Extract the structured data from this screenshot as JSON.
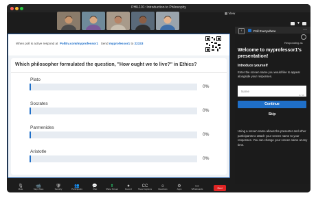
{
  "window": {
    "title": "PHIL101: Introduction to Philosophy"
  },
  "participants": [
    {
      "name": "participant-1",
      "skin": "#c8966e",
      "shirt": "#4a4a4a",
      "bg": "#8a7b6a"
    },
    {
      "name": "participant-2",
      "skin": "#d9a982",
      "shirt": "#7a5a9a",
      "bg": "#6f8a9a"
    },
    {
      "name": "participant-3",
      "skin": "#b78467",
      "shirt": "#c9bfb0",
      "bg": "#a89a8a"
    },
    {
      "name": "participant-4",
      "skin": "#8b5e45",
      "shirt": "#2f2f2f",
      "bg": "#5a6a7a"
    },
    {
      "name": "participant-5",
      "skin": "#e3b38f",
      "shirt": "#3f6ea8",
      "bg": "#9aa4ad"
    }
  ],
  "view_label": "View",
  "poll": {
    "header": {
      "prefix": "When poll is active respond at",
      "url": "PollEv.com/myprofessor1",
      "send": "Send",
      "code": "myprofessor1",
      "to": "to",
      "number": "22333"
    },
    "question": "Which philosopher formulated the question, \"How ought we to live?\" in Ethics?",
    "options": [
      {
        "label": "Plato",
        "percent": "0%",
        "fraction": 0
      },
      {
        "label": "Socrates",
        "percent": "0%",
        "fraction": 0
      },
      {
        "label": "Parmenides",
        "percent": "0%",
        "fraction": 0
      },
      {
        "label": "Aristotle",
        "percent": "0%",
        "fraction": 0
      }
    ],
    "accent": "#1f6fc8"
  },
  "sidebar": {
    "title": "Poll Everywhere",
    "responding_as": "Responding as",
    "welcome": "Welcome to myprofessor1's presentation!",
    "intro_title": "Introduce yourself",
    "intro_desc": "Enter the screen name you would like to appear alongside your responses.",
    "name_placeholder": "Name",
    "char_count": "0 / 40",
    "continue_label": "Continue",
    "skip_label": "Skip",
    "note": "Using a screen name allows the presenter and other participants to attach your screen name to your responses. You can change your screen name at any time."
  },
  "toolbar": {
    "items": [
      {
        "name": "mute",
        "label": "Mute",
        "icon": "🎙"
      },
      {
        "name": "stop-video",
        "label": "Stop Video",
        "icon": "📹"
      },
      {
        "name": "security",
        "label": "Security",
        "icon": "🛡"
      },
      {
        "name": "participants",
        "label": "Participants",
        "icon": "👥"
      },
      {
        "name": "chat",
        "label": "Chat",
        "icon": "💬"
      },
      {
        "name": "share-screen",
        "label": "Share Screen",
        "icon": "⬆"
      },
      {
        "name": "record",
        "label": "Record",
        "icon": "⏺"
      },
      {
        "name": "show-captions",
        "label": "Show Captions",
        "icon": "CC"
      },
      {
        "name": "reactions",
        "label": "Reactions",
        "icon": "☺"
      },
      {
        "name": "apps",
        "label": "Apps",
        "icon": "⚙"
      },
      {
        "name": "whiteboards",
        "label": "Whiteboards",
        "icon": "▭"
      }
    ],
    "end_label": "End"
  },
  "colors": {
    "end": "#e02424",
    "share": "#27ae60",
    "accent": "#1f6fc8"
  }
}
